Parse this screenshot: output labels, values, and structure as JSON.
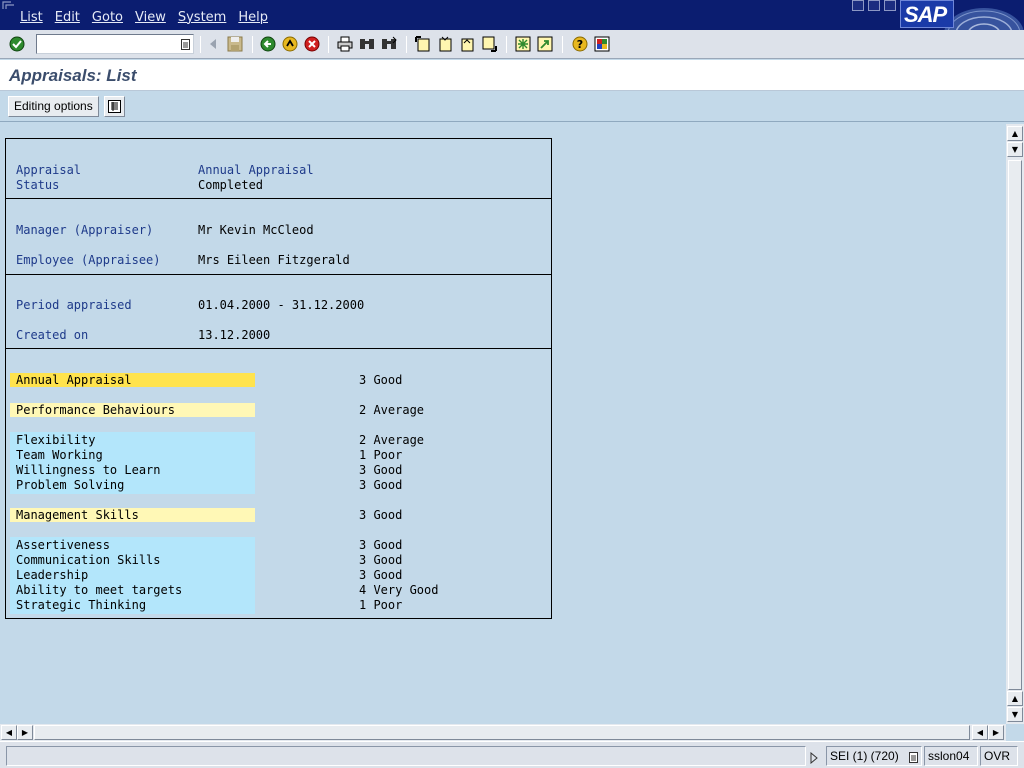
{
  "menubar": {
    "items": [
      "List",
      "Edit",
      "Goto",
      "View",
      "System",
      "Help"
    ],
    "logo": "SAP"
  },
  "toolbar": {
    "command_field_value": "",
    "icons": [
      "enter-check-icon",
      "command-dropdown-icon",
      "previous-icon",
      "save-icon",
      "back-icon",
      "exit-icon",
      "cancel-icon",
      "print-icon",
      "find-icon",
      "find-next-icon",
      "first-page-icon",
      "previous-page-icon",
      "next-page-icon",
      "last-page-icon",
      "create-session-icon",
      "create-shortcut-icon",
      "help-icon",
      "customize-layout-icon"
    ]
  },
  "title": "Appraisals: List",
  "app_toolbar": {
    "editing_options_label": "Editing options",
    "layout_icon": "list-layout-icon"
  },
  "report": {
    "header": [
      {
        "label": "Appraisal",
        "value": "Annual Appraisal"
      },
      {
        "label": "Status",
        "value": "Completed"
      }
    ],
    "people": [
      {
        "label": "Manager (Appraiser)",
        "value": "Mr Kevin McCleod"
      },
      {
        "label": "Employee (Appraisee)",
        "value": "Mrs Eileen Fitzgerald"
      }
    ],
    "dates": [
      {
        "label": "Period appraised",
        "value": "01.04.2000 - 31.12.2000"
      },
      {
        "label": "Created on",
        "value": "13.12.2000"
      }
    ],
    "criteria": [
      {
        "name": "Annual Appraisal",
        "rating": "3 Good",
        "level": "total"
      },
      {
        "name": "Performance Behaviours",
        "rating": "2 Average",
        "level": "group"
      },
      {
        "name": "Flexibility",
        "rating": "2 Average",
        "level": "item"
      },
      {
        "name": "Team Working",
        "rating": "1 Poor",
        "level": "item"
      },
      {
        "name": "Willingness to Learn",
        "rating": "3 Good",
        "level": "item"
      },
      {
        "name": "Problem Solving",
        "rating": "3 Good",
        "level": "item"
      },
      {
        "name": "Management Skills",
        "rating": "3 Good",
        "level": "group"
      },
      {
        "name": "Assertiveness",
        "rating": "3 Good",
        "level": "item"
      },
      {
        "name": "Communication Skills",
        "rating": "3 Good",
        "level": "item"
      },
      {
        "name": "Leadership",
        "rating": "3 Good",
        "level": "item"
      },
      {
        "name": "Ability to meet targets",
        "rating": "4 Very Good",
        "level": "item"
      },
      {
        "name": "Strategic Thinking",
        "rating": "1 Poor",
        "level": "item"
      }
    ]
  },
  "statusbar": {
    "message": "",
    "system": "SEI (1) (720)",
    "server": "sslon04",
    "mode": "OVR"
  },
  "colors": {
    "menubar": "#0b1d70",
    "background": "#c3d9e9",
    "total_highlight": "#ffe34d",
    "group_highlight": "#fff8b6",
    "item_highlight": "#b3e6fb",
    "label_blue": "#1e3a8a"
  }
}
